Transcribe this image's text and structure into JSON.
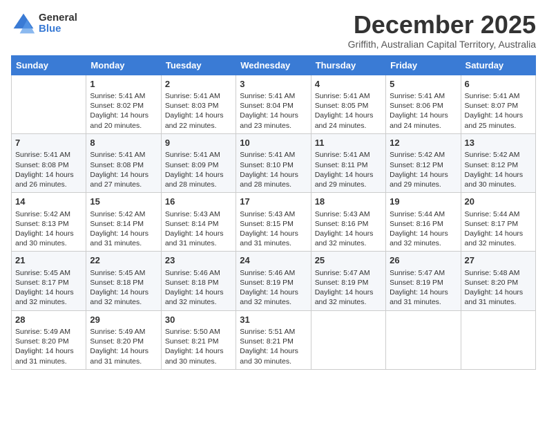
{
  "header": {
    "logo_general": "General",
    "logo_blue": "Blue",
    "month": "December 2025",
    "subtitle": "Griffith, Australian Capital Territory, Australia"
  },
  "weekdays": [
    "Sunday",
    "Monday",
    "Tuesday",
    "Wednesday",
    "Thursday",
    "Friday",
    "Saturday"
  ],
  "weeks": [
    [
      {
        "day": "",
        "sunrise": "",
        "sunset": "",
        "daylight": ""
      },
      {
        "day": "1",
        "sunrise": "Sunrise: 5:41 AM",
        "sunset": "Sunset: 8:02 PM",
        "daylight": "Daylight: 14 hours and 20 minutes."
      },
      {
        "day": "2",
        "sunrise": "Sunrise: 5:41 AM",
        "sunset": "Sunset: 8:03 PM",
        "daylight": "Daylight: 14 hours and 22 minutes."
      },
      {
        "day": "3",
        "sunrise": "Sunrise: 5:41 AM",
        "sunset": "Sunset: 8:04 PM",
        "daylight": "Daylight: 14 hours and 23 minutes."
      },
      {
        "day": "4",
        "sunrise": "Sunrise: 5:41 AM",
        "sunset": "Sunset: 8:05 PM",
        "daylight": "Daylight: 14 hours and 24 minutes."
      },
      {
        "day": "5",
        "sunrise": "Sunrise: 5:41 AM",
        "sunset": "Sunset: 8:06 PM",
        "daylight": "Daylight: 14 hours and 24 minutes."
      },
      {
        "day": "6",
        "sunrise": "Sunrise: 5:41 AM",
        "sunset": "Sunset: 8:07 PM",
        "daylight": "Daylight: 14 hours and 25 minutes."
      }
    ],
    [
      {
        "day": "7",
        "sunrise": "Sunrise: 5:41 AM",
        "sunset": "Sunset: 8:08 PM",
        "daylight": "Daylight: 14 hours and 26 minutes."
      },
      {
        "day": "8",
        "sunrise": "Sunrise: 5:41 AM",
        "sunset": "Sunset: 8:08 PM",
        "daylight": "Daylight: 14 hours and 27 minutes."
      },
      {
        "day": "9",
        "sunrise": "Sunrise: 5:41 AM",
        "sunset": "Sunset: 8:09 PM",
        "daylight": "Daylight: 14 hours and 28 minutes."
      },
      {
        "day": "10",
        "sunrise": "Sunrise: 5:41 AM",
        "sunset": "Sunset: 8:10 PM",
        "daylight": "Daylight: 14 hours and 28 minutes."
      },
      {
        "day": "11",
        "sunrise": "Sunrise: 5:41 AM",
        "sunset": "Sunset: 8:11 PM",
        "daylight": "Daylight: 14 hours and 29 minutes."
      },
      {
        "day": "12",
        "sunrise": "Sunrise: 5:42 AM",
        "sunset": "Sunset: 8:12 PM",
        "daylight": "Daylight: 14 hours and 29 minutes."
      },
      {
        "day": "13",
        "sunrise": "Sunrise: 5:42 AM",
        "sunset": "Sunset: 8:12 PM",
        "daylight": "Daylight: 14 hours and 30 minutes."
      }
    ],
    [
      {
        "day": "14",
        "sunrise": "Sunrise: 5:42 AM",
        "sunset": "Sunset: 8:13 PM",
        "daylight": "Daylight: 14 hours and 30 minutes."
      },
      {
        "day": "15",
        "sunrise": "Sunrise: 5:42 AM",
        "sunset": "Sunset: 8:14 PM",
        "daylight": "Daylight: 14 hours and 31 minutes."
      },
      {
        "day": "16",
        "sunrise": "Sunrise: 5:43 AM",
        "sunset": "Sunset: 8:14 PM",
        "daylight": "Daylight: 14 hours and 31 minutes."
      },
      {
        "day": "17",
        "sunrise": "Sunrise: 5:43 AM",
        "sunset": "Sunset: 8:15 PM",
        "daylight": "Daylight: 14 hours and 31 minutes."
      },
      {
        "day": "18",
        "sunrise": "Sunrise: 5:43 AM",
        "sunset": "Sunset: 8:16 PM",
        "daylight": "Daylight: 14 hours and 32 minutes."
      },
      {
        "day": "19",
        "sunrise": "Sunrise: 5:44 AM",
        "sunset": "Sunset: 8:16 PM",
        "daylight": "Daylight: 14 hours and 32 minutes."
      },
      {
        "day": "20",
        "sunrise": "Sunrise: 5:44 AM",
        "sunset": "Sunset: 8:17 PM",
        "daylight": "Daylight: 14 hours and 32 minutes."
      }
    ],
    [
      {
        "day": "21",
        "sunrise": "Sunrise: 5:45 AM",
        "sunset": "Sunset: 8:17 PM",
        "daylight": "Daylight: 14 hours and 32 minutes."
      },
      {
        "day": "22",
        "sunrise": "Sunrise: 5:45 AM",
        "sunset": "Sunset: 8:18 PM",
        "daylight": "Daylight: 14 hours and 32 minutes."
      },
      {
        "day": "23",
        "sunrise": "Sunrise: 5:46 AM",
        "sunset": "Sunset: 8:18 PM",
        "daylight": "Daylight: 14 hours and 32 minutes."
      },
      {
        "day": "24",
        "sunrise": "Sunrise: 5:46 AM",
        "sunset": "Sunset: 8:19 PM",
        "daylight": "Daylight: 14 hours and 32 minutes."
      },
      {
        "day": "25",
        "sunrise": "Sunrise: 5:47 AM",
        "sunset": "Sunset: 8:19 PM",
        "daylight": "Daylight: 14 hours and 32 minutes."
      },
      {
        "day": "26",
        "sunrise": "Sunrise: 5:47 AM",
        "sunset": "Sunset: 8:19 PM",
        "daylight": "Daylight: 14 hours and 31 minutes."
      },
      {
        "day": "27",
        "sunrise": "Sunrise: 5:48 AM",
        "sunset": "Sunset: 8:20 PM",
        "daylight": "Daylight: 14 hours and 31 minutes."
      }
    ],
    [
      {
        "day": "28",
        "sunrise": "Sunrise: 5:49 AM",
        "sunset": "Sunset: 8:20 PM",
        "daylight": "Daylight: 14 hours and 31 minutes."
      },
      {
        "day": "29",
        "sunrise": "Sunrise: 5:49 AM",
        "sunset": "Sunset: 8:20 PM",
        "daylight": "Daylight: 14 hours and 31 minutes."
      },
      {
        "day": "30",
        "sunrise": "Sunrise: 5:50 AM",
        "sunset": "Sunset: 8:21 PM",
        "daylight": "Daylight: 14 hours and 30 minutes."
      },
      {
        "day": "31",
        "sunrise": "Sunrise: 5:51 AM",
        "sunset": "Sunset: 8:21 PM",
        "daylight": "Daylight: 14 hours and 30 minutes."
      },
      {
        "day": "",
        "sunrise": "",
        "sunset": "",
        "daylight": ""
      },
      {
        "day": "",
        "sunrise": "",
        "sunset": "",
        "daylight": ""
      },
      {
        "day": "",
        "sunrise": "",
        "sunset": "",
        "daylight": ""
      }
    ]
  ]
}
